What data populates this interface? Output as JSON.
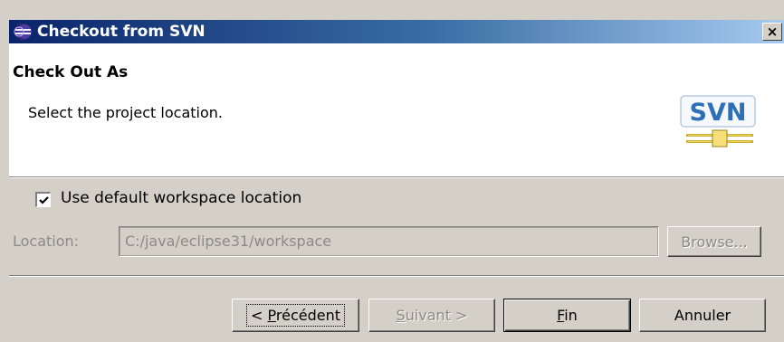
{
  "window": {
    "title": "Checkout from SVN",
    "close_label": "×"
  },
  "banner": {
    "title": "Check Out As",
    "description": "Select the project location.",
    "logo_text": "SVN"
  },
  "workspace": {
    "checkbox_label": "Use default workspace location",
    "checked": true
  },
  "location": {
    "label": "Location:",
    "value": "C:/java/eclipse31/workspace",
    "browse_label": "Browse..."
  },
  "buttons": {
    "prev": {
      "prefix": "< ",
      "mnemonic": "P",
      "rest": "récédent"
    },
    "next": {
      "mnemonic": "S",
      "rest": "uivant >"
    },
    "finish": {
      "mnemonic": "F",
      "rest": "in"
    },
    "cancel": {
      "label": "Annuler"
    }
  },
  "colors": {
    "title_gradient_start": "#0a246a",
    "title_gradient_end": "#a6caf0",
    "dialog_bg": "#d4d0c8",
    "disabled_text": "#8c8a85",
    "svn_blue": "#2e6fb7",
    "svn_yellow": "#f2d54c"
  },
  "icons": {
    "title": "eclipse-icon",
    "close": "close-icon",
    "logo": "svn-logo-icon",
    "check": "checkmark-icon"
  }
}
